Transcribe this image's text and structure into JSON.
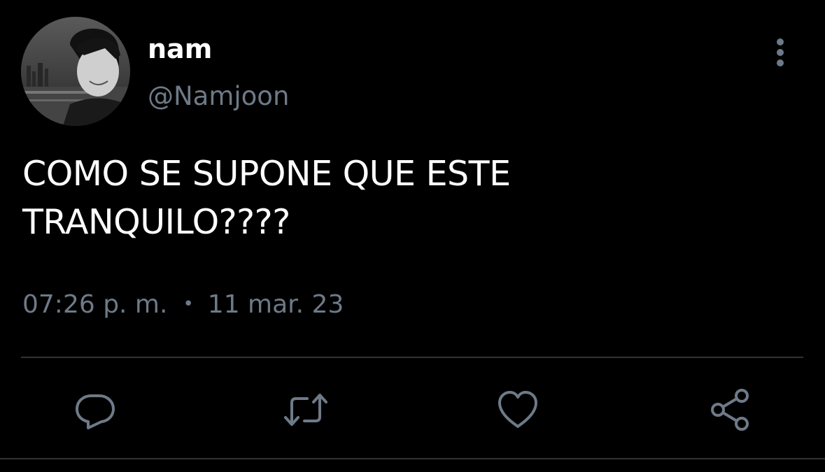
{
  "tweet": {
    "display_name": "nam",
    "handle": "@Namjoon",
    "text_lines": [
      "COMO SE SUPONE QUE ESTE",
      "TRANQUILO????"
    ],
    "time": "07:26 p. m.",
    "separator": "•",
    "date": "11 mar. 23"
  },
  "actions": {
    "reply_icon": "reply-icon",
    "retweet_icon": "retweet-icon",
    "like_icon": "heart-icon",
    "share_icon": "share-icon",
    "more_icon": "more-vertical-icon"
  },
  "colors": {
    "background": "#000000",
    "primary_text": "#ffffff",
    "secondary_text": "#6e7a87",
    "divider": "#2f3336"
  }
}
